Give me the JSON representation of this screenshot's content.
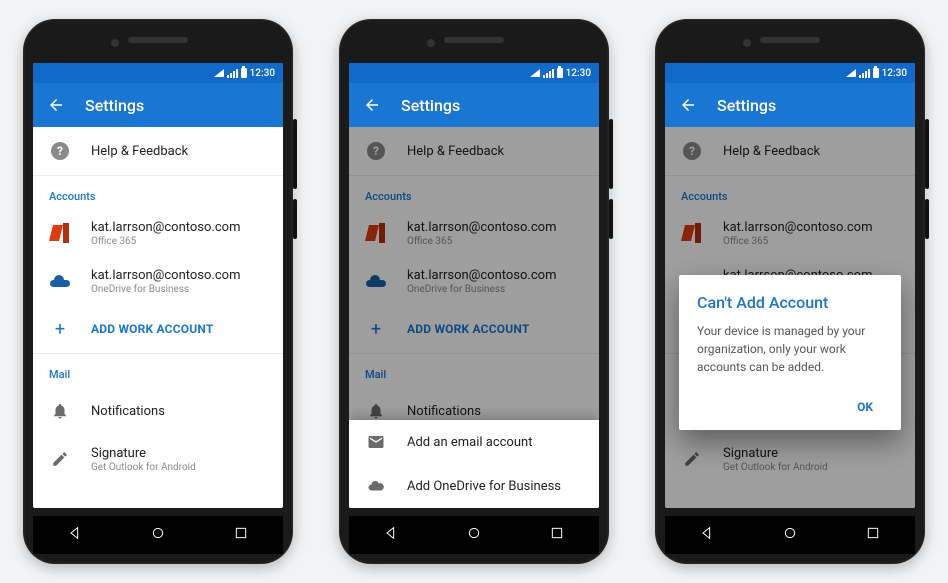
{
  "statusbar": {
    "time": "12:30"
  },
  "appbar": {
    "title": "Settings"
  },
  "help_row": {
    "label": "Help & Feedback"
  },
  "sections": {
    "accounts": "Accounts",
    "mail": "Mail"
  },
  "accounts": [
    {
      "email": "kat.larrson@contoso.com",
      "sub": "Office 365",
      "icon": "office-icon"
    },
    {
      "email": "kat.larrson@contoso.com",
      "sub": "OneDrive for Business",
      "icon": "onedrive-icon"
    }
  ],
  "add_work": "ADD WORK ACCOUNT",
  "mail_items": {
    "notifications": "Notifications",
    "signature": {
      "title": "Signature",
      "sub": "Get Outlook for Android"
    }
  },
  "sheet": {
    "add_email": "Add an email account",
    "add_odb": "Add OneDrive for Business"
  },
  "dialog": {
    "title": "Can't Add Account",
    "body": "Your device is managed by your organization, only your work accounts can be added.",
    "ok": "OK"
  }
}
